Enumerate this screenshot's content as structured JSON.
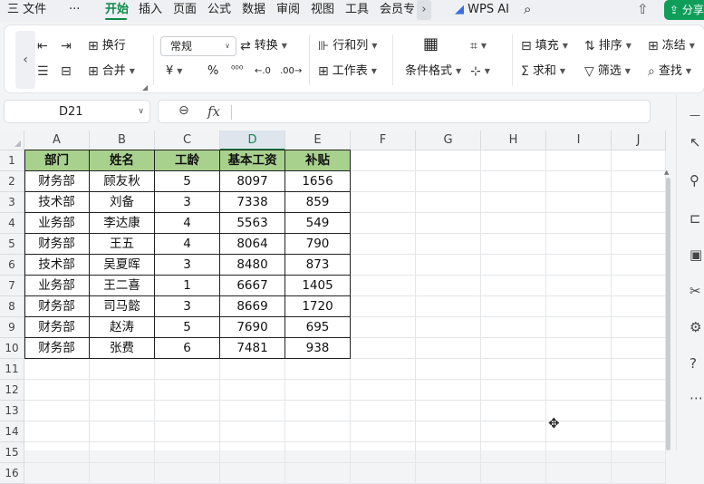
{
  "menu": {
    "file_icon": "三",
    "file": "文件",
    "more": "···",
    "tabs": [
      "开始",
      "插入",
      "页面",
      "公式",
      "数据",
      "审阅",
      "视图",
      "工具",
      "会员专"
    ],
    "scroll_right": "›",
    "wps_ai": "WPS AI",
    "share": "分享"
  },
  "ribbon": {
    "wrap": "换行",
    "merge": "合并",
    "format_combo": "常规",
    "convert": "转换",
    "rows_cols": "行和列",
    "worksheet": "工作表",
    "cond_format": "条件格式",
    "fill": "填充",
    "sort": "排序",
    "freeze": "冻结",
    "sum": "求和",
    "filter": "筛选",
    "find": "查找",
    "currency_sym": "¥",
    "percent_sym": "%",
    "thousands_sym": "⁰⁰⁰",
    "dec_less": "←.0",
    "dec_more": ".00→"
  },
  "namebox": {
    "value": "D21"
  },
  "formula": {
    "fx": "fx",
    "value": ""
  },
  "sheet": {
    "columns": [
      "A",
      "B",
      "C",
      "D",
      "E",
      "F",
      "G",
      "H",
      "I",
      "J"
    ],
    "selected_column": "D",
    "rows": [
      "1",
      "2",
      "3",
      "4",
      "5",
      "6",
      "7",
      "8",
      "9",
      "10",
      "11",
      "12",
      "13",
      "14",
      "15",
      "16"
    ],
    "header": [
      "部门",
      "姓名",
      "工龄",
      "基本工资",
      "补贴"
    ],
    "data": [
      [
        "财务部",
        "顾友秋",
        "5",
        "8097",
        "1656"
      ],
      [
        "技术部",
        "刘备",
        "3",
        "7338",
        "859"
      ],
      [
        "业务部",
        "李达康",
        "4",
        "5563",
        "549"
      ],
      [
        "财务部",
        "王五",
        "4",
        "8064",
        "790"
      ],
      [
        "技术部",
        "吴夏晖",
        "3",
        "8480",
        "873"
      ],
      [
        "业务部",
        "王二喜",
        "1",
        "6667",
        "1405"
      ],
      [
        "财务部",
        "司马懿",
        "3",
        "8669",
        "1720"
      ],
      [
        "财务部",
        "赵涛",
        "5",
        "7690",
        "695"
      ],
      [
        "财务部",
        "张费",
        "6",
        "7481",
        "938"
      ]
    ],
    "header_color": "#a9d18e"
  },
  "accent_color": "#0f8a4a"
}
